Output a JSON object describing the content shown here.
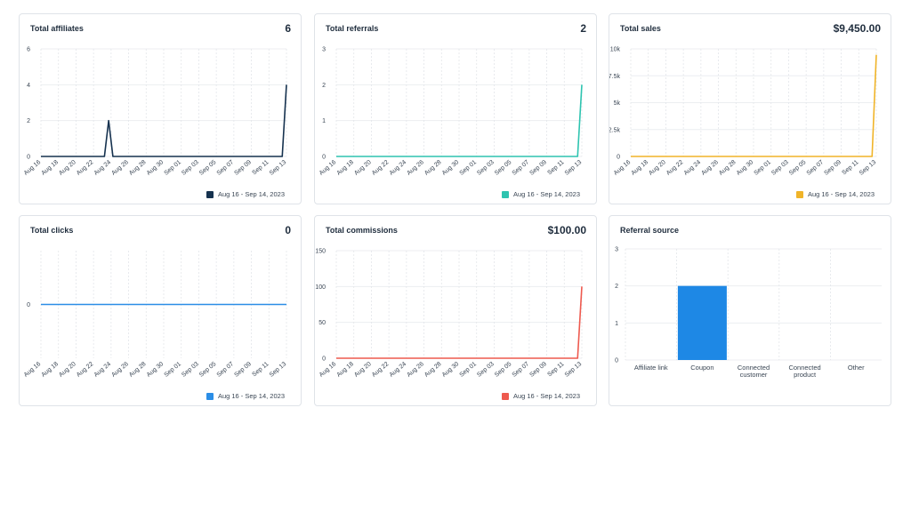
{
  "legend_label": "Aug 16 - Sep 14, 2023",
  "chart_data": [
    {
      "type": "line",
      "title": "Total affiliates",
      "value_label": "6",
      "color": "#16324f",
      "ylim": [
        0,
        6
      ],
      "yticks": [
        "0",
        "2",
        "4",
        "6"
      ],
      "yticks_values": [
        0,
        2,
        4,
        6
      ],
      "xticks": [
        "Aug 16",
        "Aug 18",
        "Aug 20",
        "Aug 22",
        "Aug 24",
        "Aug 26",
        "Aug 28",
        "Aug 30",
        "Sep 01",
        "Sep 03",
        "Sep 05",
        "Sep 07",
        "Sep 09",
        "Sep 11",
        "Sep 13"
      ],
      "series": [
        {
          "values": [
            0,
            0,
            0,
            0,
            0,
            0,
            0,
            0,
            0,
            0,
            0,
            0,
            0,
            0,
            0,
            0,
            2,
            0,
            0,
            0,
            0,
            0,
            0,
            0,
            0,
            0,
            0,
            0,
            0,
            0,
            0,
            0,
            0,
            0,
            0,
            0,
            0,
            0,
            0,
            0,
            0,
            0,
            0,
            0,
            0,
            0,
            0,
            0,
            0,
            0,
            0,
            0,
            0,
            0,
            0,
            0,
            0,
            0,
            4
          ]
        }
      ]
    },
    {
      "type": "line",
      "title": "Total referrals",
      "value_label": "2",
      "color": "#2ec4b0",
      "ylim": [
        0,
        3
      ],
      "yticks": [
        "0",
        "1",
        "2",
        "3"
      ],
      "yticks_values": [
        0,
        1,
        2,
        3
      ],
      "xticks": [
        "Aug 16",
        "Aug 18",
        "Aug 20",
        "Aug 22",
        "Aug 24",
        "Aug 26",
        "Aug 28",
        "Aug 30",
        "Sep 01",
        "Sep 03",
        "Sep 05",
        "Sep 07",
        "Sep 09",
        "Sep 11",
        "Sep 13"
      ],
      "series": [
        {
          "values": [
            0,
            0,
            0,
            0,
            0,
            0,
            0,
            0,
            0,
            0,
            0,
            0,
            0,
            0,
            0,
            0,
            0,
            0,
            0,
            0,
            0,
            0,
            0,
            0,
            0,
            0,
            0,
            0,
            0,
            0,
            0,
            0,
            0,
            0,
            0,
            0,
            0,
            0,
            0,
            0,
            0,
            0,
            0,
            0,
            0,
            0,
            0,
            0,
            0,
            0,
            0,
            0,
            0,
            0,
            0,
            0,
            0,
            0,
            2
          ]
        }
      ]
    },
    {
      "type": "line",
      "title": "Total sales",
      "value_label": "$9,450.00",
      "color": "#f0b429",
      "ylim": [
        0,
        10000
      ],
      "yticks": [
        "0",
        "2.5k",
        "5k",
        "7.5k",
        "10k"
      ],
      "yticks_values": [
        0,
        2500,
        5000,
        7500,
        10000
      ],
      "xticks": [
        "Aug 16",
        "Aug 18",
        "Aug 20",
        "Aug 22",
        "Aug 24",
        "Aug 26",
        "Aug 28",
        "Aug 30",
        "Sep 01",
        "Sep 03",
        "Sep 05",
        "Sep 07",
        "Sep 09",
        "Sep 11",
        "Sep 13"
      ],
      "series": [
        {
          "values": [
            0,
            0,
            0,
            0,
            0,
            0,
            0,
            0,
            0,
            0,
            0,
            0,
            0,
            0,
            0,
            0,
            0,
            0,
            0,
            0,
            0,
            0,
            0,
            0,
            0,
            0,
            0,
            0,
            0,
            0,
            0,
            0,
            0,
            0,
            0,
            0,
            0,
            0,
            0,
            0,
            0,
            0,
            0,
            0,
            0,
            0,
            0,
            0,
            0,
            0,
            0,
            0,
            0,
            0,
            0,
            0,
            0,
            0,
            9450
          ]
        }
      ]
    },
    {
      "type": "line",
      "title": "Total clicks",
      "value_label": "0",
      "color": "#2b8ee6",
      "ylim": [
        -1,
        1
      ],
      "yticks": [
        "0"
      ],
      "yticks_values": [
        0
      ],
      "xticks": [
        "Aug 16",
        "Aug 18",
        "Aug 20",
        "Aug 22",
        "Aug 24",
        "Aug 26",
        "Aug 28",
        "Aug 30",
        "Sep 01",
        "Sep 03",
        "Sep 05",
        "Sep 07",
        "Sep 09",
        "Sep 11",
        "Sep 13"
      ],
      "series": [
        {
          "values": [
            0,
            0,
            0,
            0,
            0,
            0,
            0,
            0,
            0,
            0,
            0,
            0,
            0,
            0,
            0,
            0,
            0,
            0,
            0,
            0,
            0,
            0,
            0,
            0,
            0,
            0,
            0,
            0,
            0,
            0,
            0,
            0,
            0,
            0,
            0,
            0,
            0,
            0,
            0,
            0,
            0,
            0,
            0,
            0,
            0,
            0,
            0,
            0,
            0,
            0,
            0,
            0,
            0,
            0,
            0,
            0,
            0,
            0,
            0
          ]
        }
      ]
    },
    {
      "type": "line",
      "title": "Total commissions",
      "value_label": "$100.00",
      "color": "#ee5a4f",
      "ylim": [
        0,
        150
      ],
      "yticks": [
        "0",
        "50",
        "100",
        "150"
      ],
      "yticks_values": [
        0,
        50,
        100,
        150
      ],
      "xticks": [
        "Aug 16",
        "Aug 18",
        "Aug 20",
        "Aug 22",
        "Aug 24",
        "Aug 26",
        "Aug 28",
        "Aug 30",
        "Sep 01",
        "Sep 03",
        "Sep 05",
        "Sep 07",
        "Sep 09",
        "Sep 11",
        "Sep 13"
      ],
      "series": [
        {
          "values": [
            0,
            0,
            0,
            0,
            0,
            0,
            0,
            0,
            0,
            0,
            0,
            0,
            0,
            0,
            0,
            0,
            0,
            0,
            0,
            0,
            0,
            0,
            0,
            0,
            0,
            0,
            0,
            0,
            0,
            0,
            0,
            0,
            0,
            0,
            0,
            0,
            0,
            0,
            0,
            0,
            0,
            0,
            0,
            0,
            0,
            0,
            0,
            0,
            0,
            0,
            0,
            0,
            0,
            0,
            0,
            0,
            0,
            0,
            100
          ]
        }
      ]
    },
    {
      "type": "bar",
      "title": "Referral source",
      "color": "#1e88e5",
      "ylim": [
        0,
        3
      ],
      "yticks": [
        "0",
        "1",
        "2",
        "3"
      ],
      "yticks_values": [
        0,
        1,
        2,
        3
      ],
      "categories": [
        [
          "Affiliate link"
        ],
        [
          "Coupon"
        ],
        [
          "Connected",
          "customer"
        ],
        [
          "Connected",
          "product"
        ],
        [
          "Other"
        ]
      ],
      "values": [
        0,
        2,
        0,
        0,
        0
      ]
    }
  ]
}
